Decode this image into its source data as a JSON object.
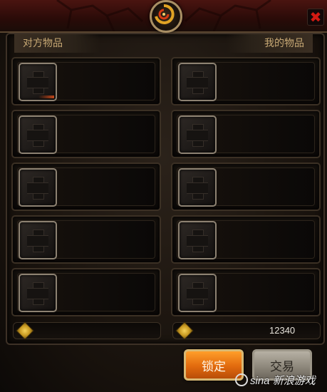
{
  "dialog": {
    "close_icon": "close-x-icon",
    "emblem_icon": "spiral-emblem-icon",
    "colors": {
      "accent": "#e26a0e",
      "frame": "#3b3024",
      "header_text": "#c7a874",
      "close": "#d21a12"
    }
  },
  "left_panel": {
    "title": "对方物品",
    "slots": [
      {
        "icon": "empty-slot-cross-icon"
      },
      {
        "icon": "empty-slot-cross-icon"
      },
      {
        "icon": "empty-slot-cross-icon"
      },
      {
        "icon": "empty-slot-cross-icon"
      },
      {
        "icon": "empty-slot-cross-icon"
      }
    ],
    "gold": {
      "icon": "gold-coin-icon",
      "value": ""
    }
  },
  "right_panel": {
    "title": "我的物品",
    "slots": [
      {
        "icon": "empty-slot-cross-icon"
      },
      {
        "icon": "empty-slot-cross-icon"
      },
      {
        "icon": "empty-slot-cross-icon"
      },
      {
        "icon": "empty-slot-cross-icon"
      },
      {
        "icon": "empty-slot-cross-icon"
      }
    ],
    "gold": {
      "icon": "gold-coin-icon",
      "value": "12340"
    }
  },
  "actions": {
    "lock_label": "锁定",
    "trade_label": "交易"
  },
  "watermark": {
    "brand": "sina",
    "text": "新浪游戏"
  }
}
